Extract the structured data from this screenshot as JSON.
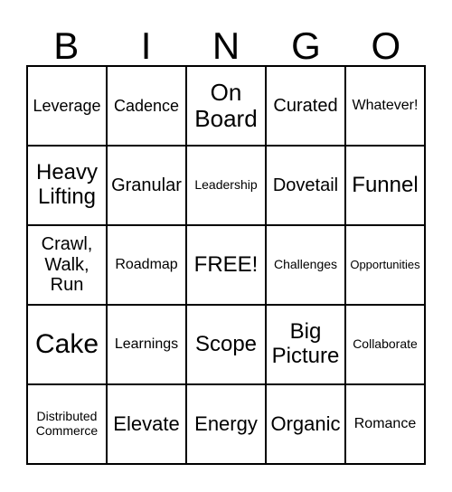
{
  "header": [
    "B",
    "I",
    "N",
    "G",
    "O"
  ],
  "cells": [
    [
      "Leverage",
      "Cadence",
      "On\nBoard",
      "Curated",
      "Whatever!"
    ],
    [
      "Heavy\nLifting",
      "Granular",
      "Leadership",
      "Dovetail",
      "Funnel"
    ],
    [
      "Crawl,\nWalk,\nRun",
      "Roadmap",
      "FREE!",
      "Challenges",
      "Opportunities"
    ],
    [
      "Cake",
      "Learnings",
      "Scope",
      "Big\nPicture",
      "Collaborate"
    ],
    [
      "Distributed\nCommerce",
      "Elevate",
      "Energy",
      "Organic",
      "Romance"
    ]
  ]
}
